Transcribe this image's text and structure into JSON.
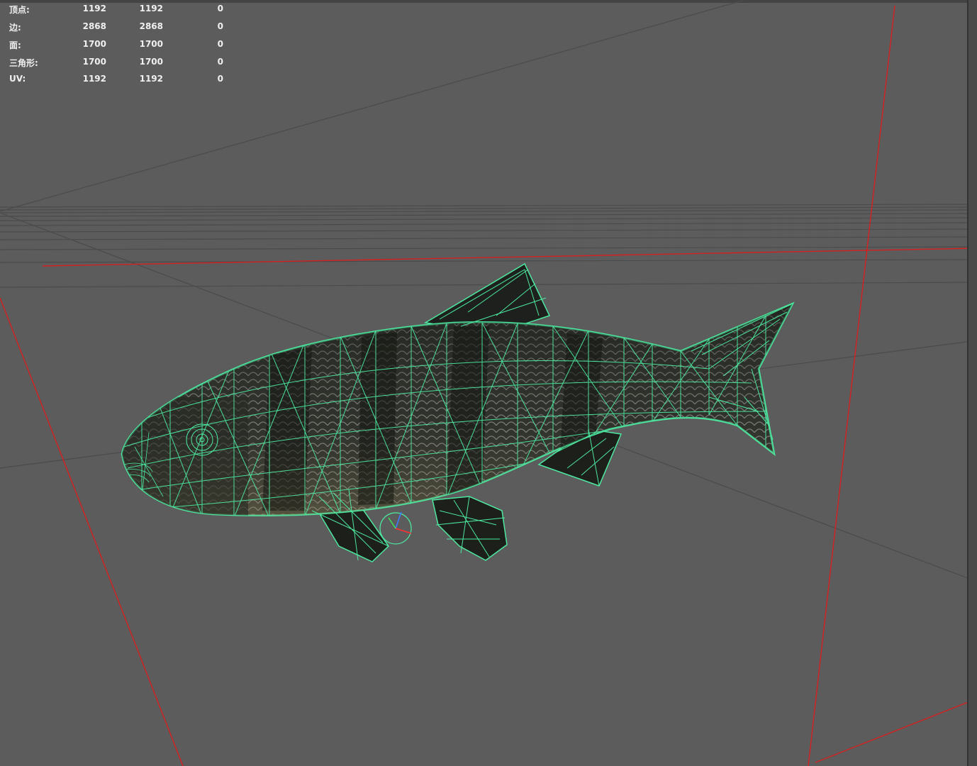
{
  "hud": {
    "rows": [
      {
        "label": "顶点:",
        "total": "1192",
        "selected": "1192",
        "extra": "0"
      },
      {
        "label": "边:",
        "total": "2868",
        "selected": "2868",
        "extra": "0"
      },
      {
        "label": "面:",
        "total": "1700",
        "selected": "1700",
        "extra": "0"
      },
      {
        "label": "三角形:",
        "total": "1700",
        "selected": "1700",
        "extra": "0"
      },
      {
        "label": "UV:",
        "total": "1192",
        "selected": "1192",
        "extra": "0"
      }
    ]
  },
  "viewport": {
    "background": "#5c5c5c",
    "grid_color": "#4a4a4a",
    "axis_red": "#d01818",
    "wireframe_color": "#4de8a0"
  },
  "model": {
    "object": "fish-mesh",
    "selected": true
  }
}
